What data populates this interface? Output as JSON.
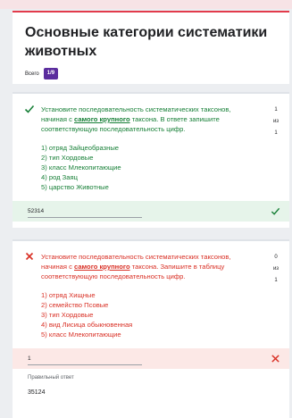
{
  "header": {
    "title": "Основные категории систематики животных",
    "counter_label": "Всего",
    "counter_value": "1/9"
  },
  "questions": [
    {
      "status": "correct",
      "text_before": "Установите последовательность систематических таксонов, начиная с ",
      "text_emph": "самого крупного",
      "text_after": " таксона. В ответе запишите соответствующую последовательность цифр.",
      "score": {
        "earned": "1",
        "of_label": "из",
        "total": "1"
      },
      "options": [
        "1) отряд Зайцеобразные",
        "2) тип Хордовые",
        "3) класс Млекопитающие",
        "4) род Заяц",
        "5) царство Животные"
      ],
      "answer": "52314"
    },
    {
      "status": "incorrect",
      "text_before": "Установите последовательность систематических таксонов, начиная с ",
      "text_emph": "самого крупного",
      "text_after": " таксона. Запишите в таблицу соответствующую последовательность цифр.",
      "score": {
        "earned": "0",
        "of_label": "из",
        "total": "1"
      },
      "options": [
        "1) отряд Хищные",
        "2) семейство Псовые",
        "3) тип Хордовые",
        "4) вид Лисица обыкновенная",
        "5) класс Млекопитающие"
      ],
      "answer": "1",
      "correct_label": "Правильный ответ",
      "correct_answer": "35124"
    }
  ],
  "colors": {
    "correct": "#188038",
    "incorrect": "#d93025",
    "badge": "#5b2d9e",
    "accent": "#e23b4b"
  }
}
